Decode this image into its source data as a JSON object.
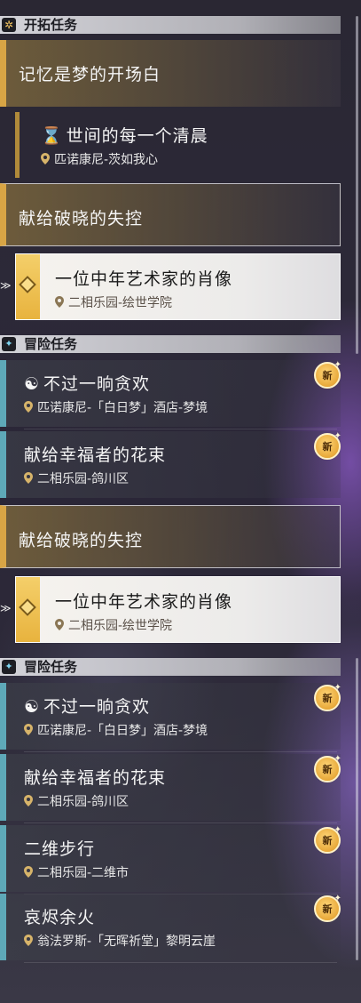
{
  "panel1": {
    "trailblaze_header": {
      "icon": "trailblaze-mission-icon",
      "label": "开拓任务"
    },
    "mission_memory": {
      "title": "记忆是梦的开场白"
    },
    "mission_morning": {
      "icon": "hourglass-icon",
      "icon_glyph": "⌛",
      "title": "世间的每一个清晨",
      "location": "匹诺康尼-茨如我心"
    },
    "mission_dawn": {
      "title": "献给破晓的失控"
    },
    "mission_portrait": {
      "title": "一位中年艺术家的肖像",
      "location": "二相乐园-绘世学院"
    },
    "adventure_header": {
      "icon": "adventure-mission-icon",
      "label": "冒险任务"
    },
    "adventure_items": [
      {
        "title": "不过一晌贪欢",
        "location": "匹诺康尼-「白日梦」酒店-梦境",
        "badge": "新",
        "type_icon": "dream-mission-icon"
      },
      {
        "title": "献给幸福者的花束",
        "location": "二相乐园-鸽川区",
        "badge": "新"
      }
    ]
  },
  "panel2": {
    "mission_dawn": {
      "title": "献给破晓的失控"
    },
    "mission_portrait": {
      "title": "一位中年艺术家的肖像",
      "location": "二相乐园-绘世学院"
    },
    "adventure_header": {
      "icon": "adventure-mission-icon",
      "label": "冒险任务"
    },
    "adventure_items": [
      {
        "title": "不过一晌贪欢",
        "location": "匹诺康尼-「白日梦」酒店-梦境",
        "badge": "新",
        "type_icon": "dream-mission-icon"
      },
      {
        "title": "献给幸福者的花束",
        "location": "二相乐园-鸽川区",
        "badge": "新"
      },
      {
        "title": "二维步行",
        "location": "二相乐园-二维市",
        "badge": "新"
      },
      {
        "title": "哀烬余火",
        "location": "翁法罗斯-「无晖祈堂」黎明云崖",
        "badge": "新"
      }
    ]
  },
  "colors": {
    "trailblaze_accent": "#d8a545",
    "adventure_accent": "#5ea9b8",
    "selected_bg": "#f6f3ee",
    "badge_gold": "#e8a93a"
  }
}
